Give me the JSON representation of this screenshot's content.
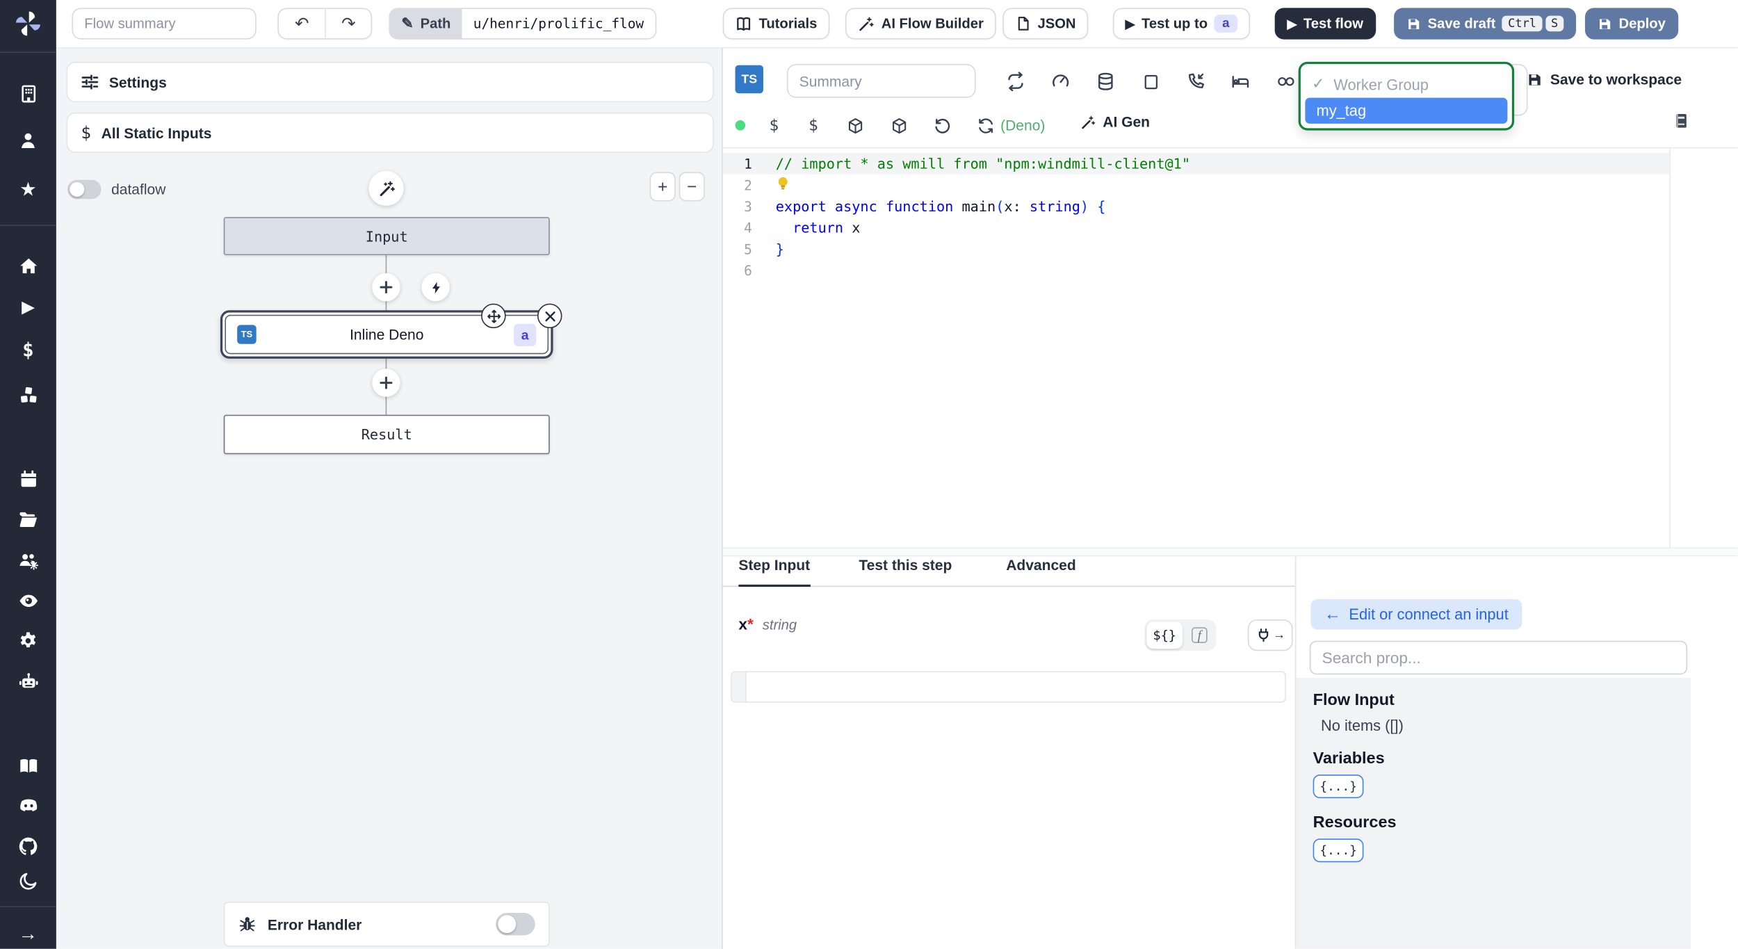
{
  "topbar": {
    "flow_summary_placeholder": "Flow summary",
    "undo_icon": "undo-arrow",
    "redo_icon": "redo-arrow",
    "path_label": "Path",
    "path_value": "u/henri/prolific_flow",
    "tutorials_label": "Tutorials",
    "ai_flow_builder_label": "AI Flow Builder",
    "json_label": "JSON",
    "test_up_to_label": "Test up to",
    "test_up_to_badge": "a",
    "test_flow_label": "Test flow",
    "save_draft_label": "Save draft",
    "save_draft_keys": [
      "Ctrl",
      "S"
    ],
    "deploy_label": "Deploy"
  },
  "sidebar": {
    "icons": [
      "workspace-building-icon",
      "user-icon",
      "favorites-star-icon",
      "home-icon",
      "runs-play-icon",
      "variables-dollar-icon",
      "resources-cubes-icon",
      "schedules-calendar-icon",
      "folders-icon",
      "groups-icon",
      "audit-eye-icon",
      "settings-gear-icon",
      "workers-robot-icon",
      "docs-book-icon",
      "discord-icon",
      "github-icon",
      "dark-mode-moon-icon",
      "expand-arrow-icon"
    ]
  },
  "flow_panel": {
    "settings_label": "Settings",
    "all_static_inputs_label": "All Static Inputs",
    "dataflow_label": "dataflow",
    "zoom_in": "+",
    "zoom_out": "−",
    "nodes": {
      "input_label": "Input",
      "step_lang_badge": "TS",
      "step_label": "Inline Deno",
      "step_badge": "a",
      "result_label": "Result"
    },
    "error_handler_label": "Error Handler"
  },
  "editor": {
    "lang_badge": "TS",
    "summary_placeholder": "Summary",
    "toolbar_icons_row1": [
      "repeat-icon",
      "gauge-icon",
      "database-icon",
      "square-icon",
      "phone-incoming-icon",
      "bed-icon",
      "link-icon"
    ],
    "toolbar_icons_row2": [
      "green-dot-icon",
      "dollar-icon",
      "dollar-icon",
      "box-icon",
      "box-icon",
      "history-icon",
      "reload-icon"
    ],
    "lang_indicator": "(Deno)",
    "ai_gen_label": "AI Gen",
    "worker_group": {
      "check": "✓",
      "label": "Worker Group",
      "selected_option": "my_tag"
    },
    "save_to_workspace_label": "Save to workspace",
    "code": {
      "lines": [
        [
          {
            "t": "// import * as wmill from \"npm:windmill-client@1\"",
            "c": "c"
          }
        ],
        [
          {
            "bulb": true
          }
        ],
        [
          {
            "t": "export",
            "c": "k"
          },
          {
            "t": " ",
            "c": "t"
          },
          {
            "t": "async",
            "c": "k"
          },
          {
            "t": " ",
            "c": "t"
          },
          {
            "t": "function",
            "c": "k"
          },
          {
            "t": " main",
            "c": "t"
          },
          {
            "t": "(",
            "c": "p"
          },
          {
            "t": "x",
            "c": "t"
          },
          {
            "t": ": ",
            "c": "t"
          },
          {
            "t": "string",
            "c": "k"
          },
          {
            "t": ")",
            "c": "p"
          },
          {
            "t": " ",
            "c": "t"
          },
          {
            "t": "{",
            "c": "p"
          }
        ],
        [
          {
            "t": "  ",
            "c": "t"
          },
          {
            "t": "return",
            "c": "k"
          },
          {
            "t": " x",
            "c": "t"
          }
        ],
        [
          {
            "t": "}",
            "c": "p"
          }
        ],
        []
      ]
    }
  },
  "bottom": {
    "tabs": [
      "Step Input",
      "Test this step",
      "Advanced"
    ],
    "active_tab": "Step Input",
    "field": {
      "name": "x",
      "required_mark": "*",
      "type": "string"
    },
    "toggle_template": "${}",
    "toggle_fn": "f"
  },
  "prop_panel": {
    "back_arrow": "←",
    "edit_connect_label": "Edit or connect an input",
    "search_placeholder": "Search prop...",
    "sections": [
      {
        "title": "Flow Input",
        "empty": "No items ([])"
      },
      {
        "title": "Variables",
        "chip": "{...}"
      },
      {
        "title": "Resources",
        "chip": "{...}"
      }
    ]
  },
  "colors": {
    "rail_bg": "#232936",
    "panel_bg": "#f3f4f6",
    "slate_button": "#5f79a3",
    "dark_button": "#252d3d",
    "dropdown_green_border": "#15803d",
    "selected_option_blue": "#4c8bf5",
    "badge_indigo_bg": "#dfe3fd",
    "badge_indigo_text": "#4840c6",
    "ts_badge_blue": "#3178c6",
    "code_comment": "#008000",
    "code_keyword": "#0000ff",
    "lang_indicator_green": "#4caf6e",
    "edit_pill_bg": "#dbe7fb",
    "edit_pill_text": "#2563eb",
    "green_dot": "#4ade80"
  }
}
